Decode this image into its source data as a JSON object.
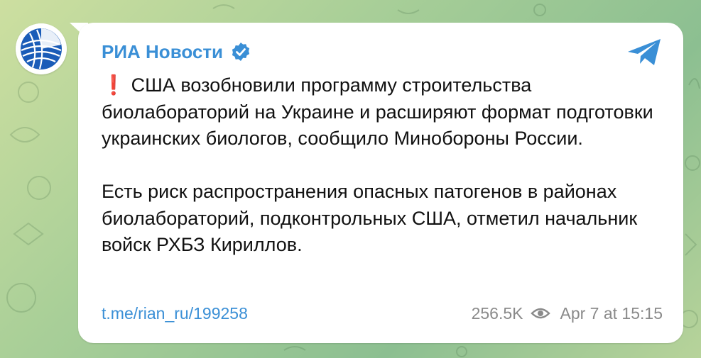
{
  "channel": {
    "name": "РИА Новости",
    "verified": true
  },
  "message": {
    "emoji": "❗",
    "paragraphs": [
      "США возобновили программу строительства биолабораторий на Украине и расширяют формат подготовки украинских биологов, сообщило Минобороны России.",
      "Есть риск распространения опасных патогенов в районах биолабораторий, подконтрольных США, отметил начальник войск РХБЗ Кириллов."
    ],
    "link": "t.me/rian_ru/199258",
    "views": "256.5K",
    "timestamp": "Apr 7 at 15:15"
  },
  "icons": {
    "avatar": "ria-globe-logo",
    "verified": "verified-badge-icon",
    "share": "telegram-plane-icon",
    "views": "eye-icon"
  },
  "colors": {
    "accent": "#3a8fd6",
    "emoji_red": "#d9232d",
    "meta_gray": "#8a8a8a",
    "background_start": "#cddfa0",
    "background_end": "#8cbf91"
  }
}
